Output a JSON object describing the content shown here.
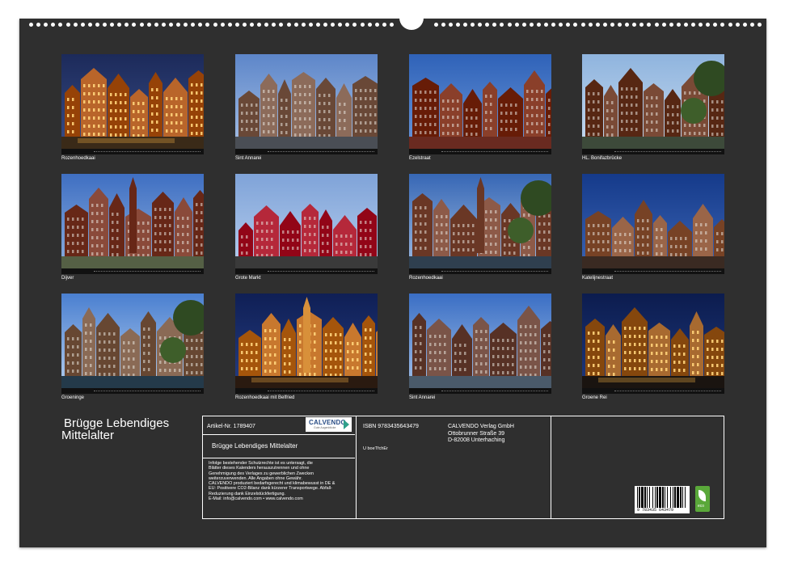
{
  "photos": [
    {
      "caption": "Rozenhoedkaai",
      "scene": "night-canal",
      "sky": "#1c2a5a",
      "sky2": "#3a4f8a",
      "build": "#b9652a",
      "water": "#3a2a18",
      "lit": true
    },
    {
      "caption": "Sint Annarei",
      "scene": "canal-row",
      "sky": "#5d86c9",
      "sky2": "#a9c2e6",
      "build": "#8c6b5a",
      "water": "#4a4e55",
      "lit": false
    },
    {
      "caption": "Ezelstraat",
      "scene": "gables-close",
      "sky": "#2f62b8",
      "sky2": "#6d99db",
      "build": "#8a3f2a",
      "water": "#6a2a20",
      "lit": false
    },
    {
      "caption": "HL. Bonifazbrücke",
      "scene": "bridge-trees",
      "sky": "#8fb4de",
      "sky2": "#c9dcf0",
      "build": "#7a4a36",
      "water": "#3d4a3a",
      "lit": false
    },
    {
      "caption": "Dijver",
      "scene": "tower-street",
      "sky": "#3f6fc2",
      "sky2": "#8fb1e0",
      "build": "#8a4a3a",
      "water": "#556045",
      "lit": false
    },
    {
      "caption": "Grote Markt",
      "scene": "market-gables",
      "sky": "#7fa3d8",
      "sky2": "#b8cfee",
      "build": "#b5283a",
      "water": "#3a3a3a",
      "lit": false
    },
    {
      "caption": "Rozenhoedkaai",
      "scene": "canal-tower",
      "sky": "#3767b5",
      "sky2": "#a3bfe4",
      "build": "#8d5a48",
      "water": "#2f3f4f",
      "lit": false
    },
    {
      "caption": "Katelijnestraat",
      "scene": "stepped-gables",
      "sky": "#153a8a",
      "sky2": "#3d66b5",
      "build": "#9a6548",
      "water": "#3a2a22",
      "lit": false
    },
    {
      "caption": "Groeninge",
      "scene": "reflection",
      "sky": "#4a7fd0",
      "sky2": "#b9d2ef",
      "build": "#8a6a55",
      "water": "#243a4a",
      "lit": false
    },
    {
      "caption": "Rozenhoedkaai mit Belfried",
      "scene": "night-belfry",
      "sky": "#0f1f55",
      "sky2": "#273f85",
      "build": "#c8782e",
      "water": "#2a1a10",
      "lit": true
    },
    {
      "caption": "Sint Annarei",
      "scene": "canal-street",
      "sky": "#3a6ec4",
      "sky2": "#a8c5ea",
      "build": "#7a5448",
      "water": "#4a5a6a",
      "lit": false
    },
    {
      "caption": "Groene Rei",
      "scene": "night-reflection",
      "sky": "#0c1c4e",
      "sky2": "#1f3a80",
      "build": "#a86a30",
      "water": "#1a1410",
      "lit": true
    }
  ],
  "title": {
    "line1": "Brügge Lebendiges",
    "line2": "Mittelalter"
  },
  "info": {
    "article": "Artikel-Nr. 1789407",
    "calvendo_logo": "CALVENDO",
    "calvendo_sub": "Gute Augenblicke",
    "product_title": "Brügge Lebendiges Mittelalter",
    "legal": [
      "Infolge bestehender Schutzrechte ist es untersagt, die",
      "Blätter dieses Kalenders herauszutrennen und ohne",
      "Genehmigung des Verlages zu gewerblichen Zwecken",
      "weiterzuverwenden. Alle Angaben ohne Gewähr.",
      "CALVENDO produziert bedarfsgerecht und klimabewusst in DE &",
      "EU: Positivere CO2-Bilanz dank kürzerer Transportwege. Abfall-",
      "Reduzierung dank Einzelstückfertigung.",
      "E-Mail: info@calvendo.com • www.calvendo.com"
    ],
    "isbn": "ISBN 9783435643479",
    "publisher": [
      "CALVENDO Verlag GmbH",
      "Ottobrunner Straße 39",
      "D-82008 Unterhaching"
    ],
    "misc": "U boeTfchEr",
    "barcode_number": "9 783435 643479",
    "eco_label": "eco"
  },
  "colors": {
    "sheet": "#2f2f2f",
    "text": "#ffffff",
    "eco": "#5aa83a"
  }
}
